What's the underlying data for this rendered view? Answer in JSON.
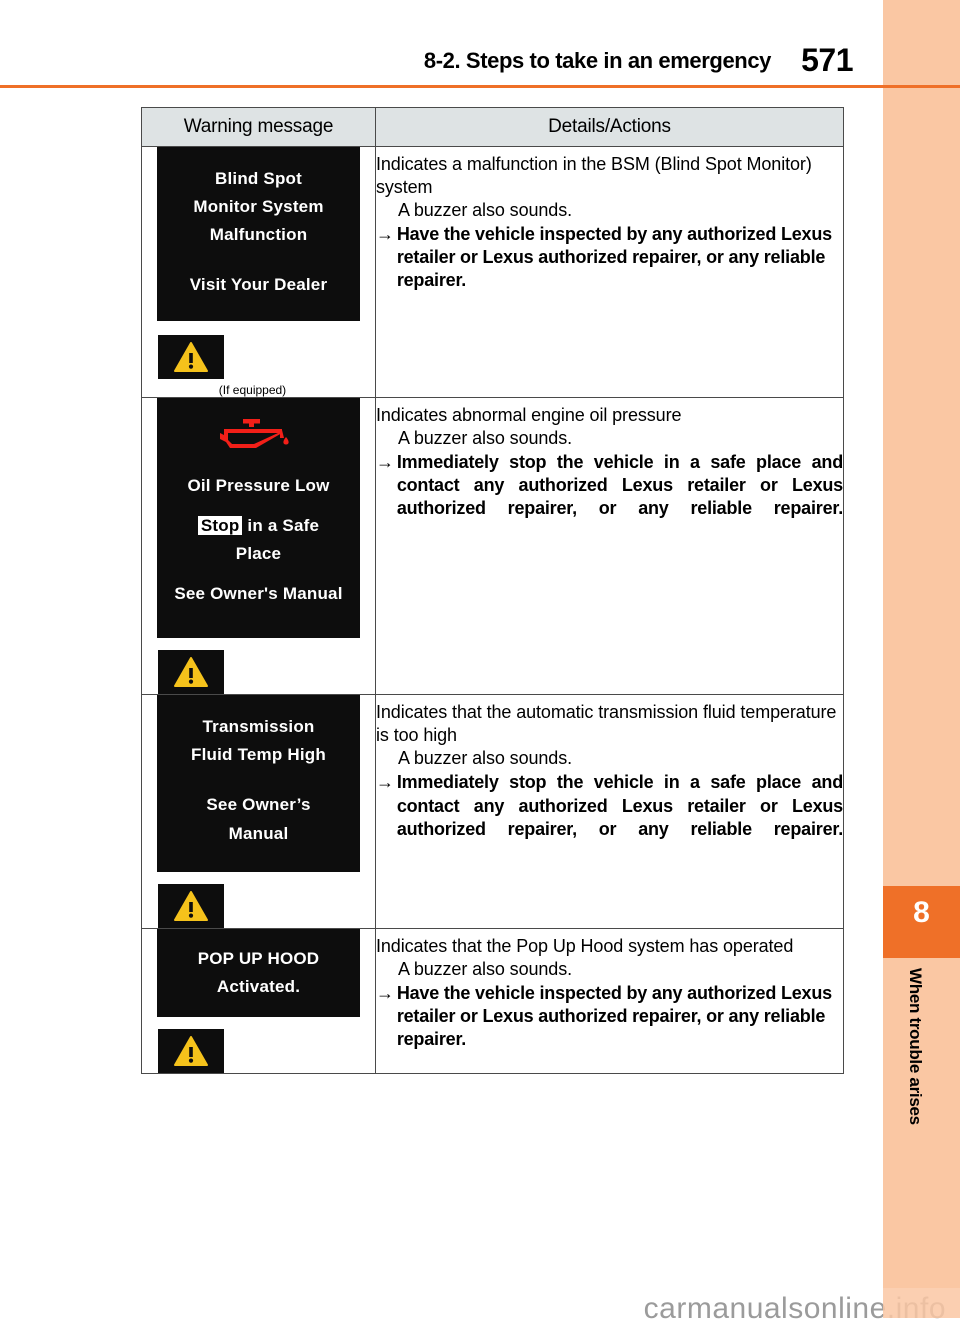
{
  "header": {
    "section_title": "8-2. Steps to take in an emergency",
    "page_number": "571"
  },
  "sidebar": {
    "chapter_number": "8",
    "chapter_title": "When trouble arises",
    "accent_color": "#ef7028",
    "background_color": "#fac7a3"
  },
  "table": {
    "columns": {
      "warning_message": "Warning message",
      "details_actions": "Details/Actions"
    },
    "rows": [
      {
        "display_lines": [
          "Blind Spot",
          "Monitor System",
          "Malfunction",
          "",
          "Visit Your Dealer"
        ],
        "indicator_icon": "warning-triangle-icon",
        "note": "(If equipped)",
        "details": {
          "lead": "Indicates a malfunction in the BSM (Blind Spot Monitor) system",
          "sub": "A buzzer also sounds.",
          "arrow": "→",
          "action": "Have the vehicle inspected by any authorized Lexus retailer or Lexus authorized repairer, or any reliable repairer."
        }
      },
      {
        "display_icon": "oil-pressure-icon",
        "display_lines": [
          "Oil Pressure Low",
          "",
          "Stop| in a Safe",
          "Place",
          "",
          "See Owner's Manual"
        ],
        "stop_chip": "Stop",
        "stop_rest": " in a Safe",
        "indicator_icon": "warning-triangle-icon",
        "details": {
          "lead": "Indicates abnormal engine oil pressure",
          "sub": "A buzzer also sounds.",
          "arrow": "→",
          "action": "Immediately stop the vehicle in a safe place and contact any authorized Lexus retailer or Lexus authorized repairer, or any reliable repairer."
        }
      },
      {
        "display_lines": [
          "Transmission",
          "Fluid Temp High",
          "",
          "See Owner’s",
          "Manual"
        ],
        "indicator_icon": "warning-triangle-icon",
        "details": {
          "lead": "Indicates that the automatic transmission fluid temperature is too high",
          "sub": "A buzzer also sounds.",
          "arrow": "→",
          "action": "Immediately stop the vehicle in a safe place and contact any authorized Lexus retailer or Lexus authorized repairer, or any reliable repairer."
        }
      },
      {
        "display_lines": [
          "POP UP HOOD",
          "Activated."
        ],
        "indicator_icon": "warning-triangle-icon",
        "details": {
          "lead": "Indicates that the Pop Up Hood system has operated",
          "sub": "A buzzer also sounds.",
          "arrow": "→",
          "action": "Have the vehicle inspected by any authorized Lexus retailer or Lexus authorized repairer, or any reliable repairer."
        }
      }
    ]
  },
  "watermark": {
    "text": "carmanualsonline.info"
  }
}
